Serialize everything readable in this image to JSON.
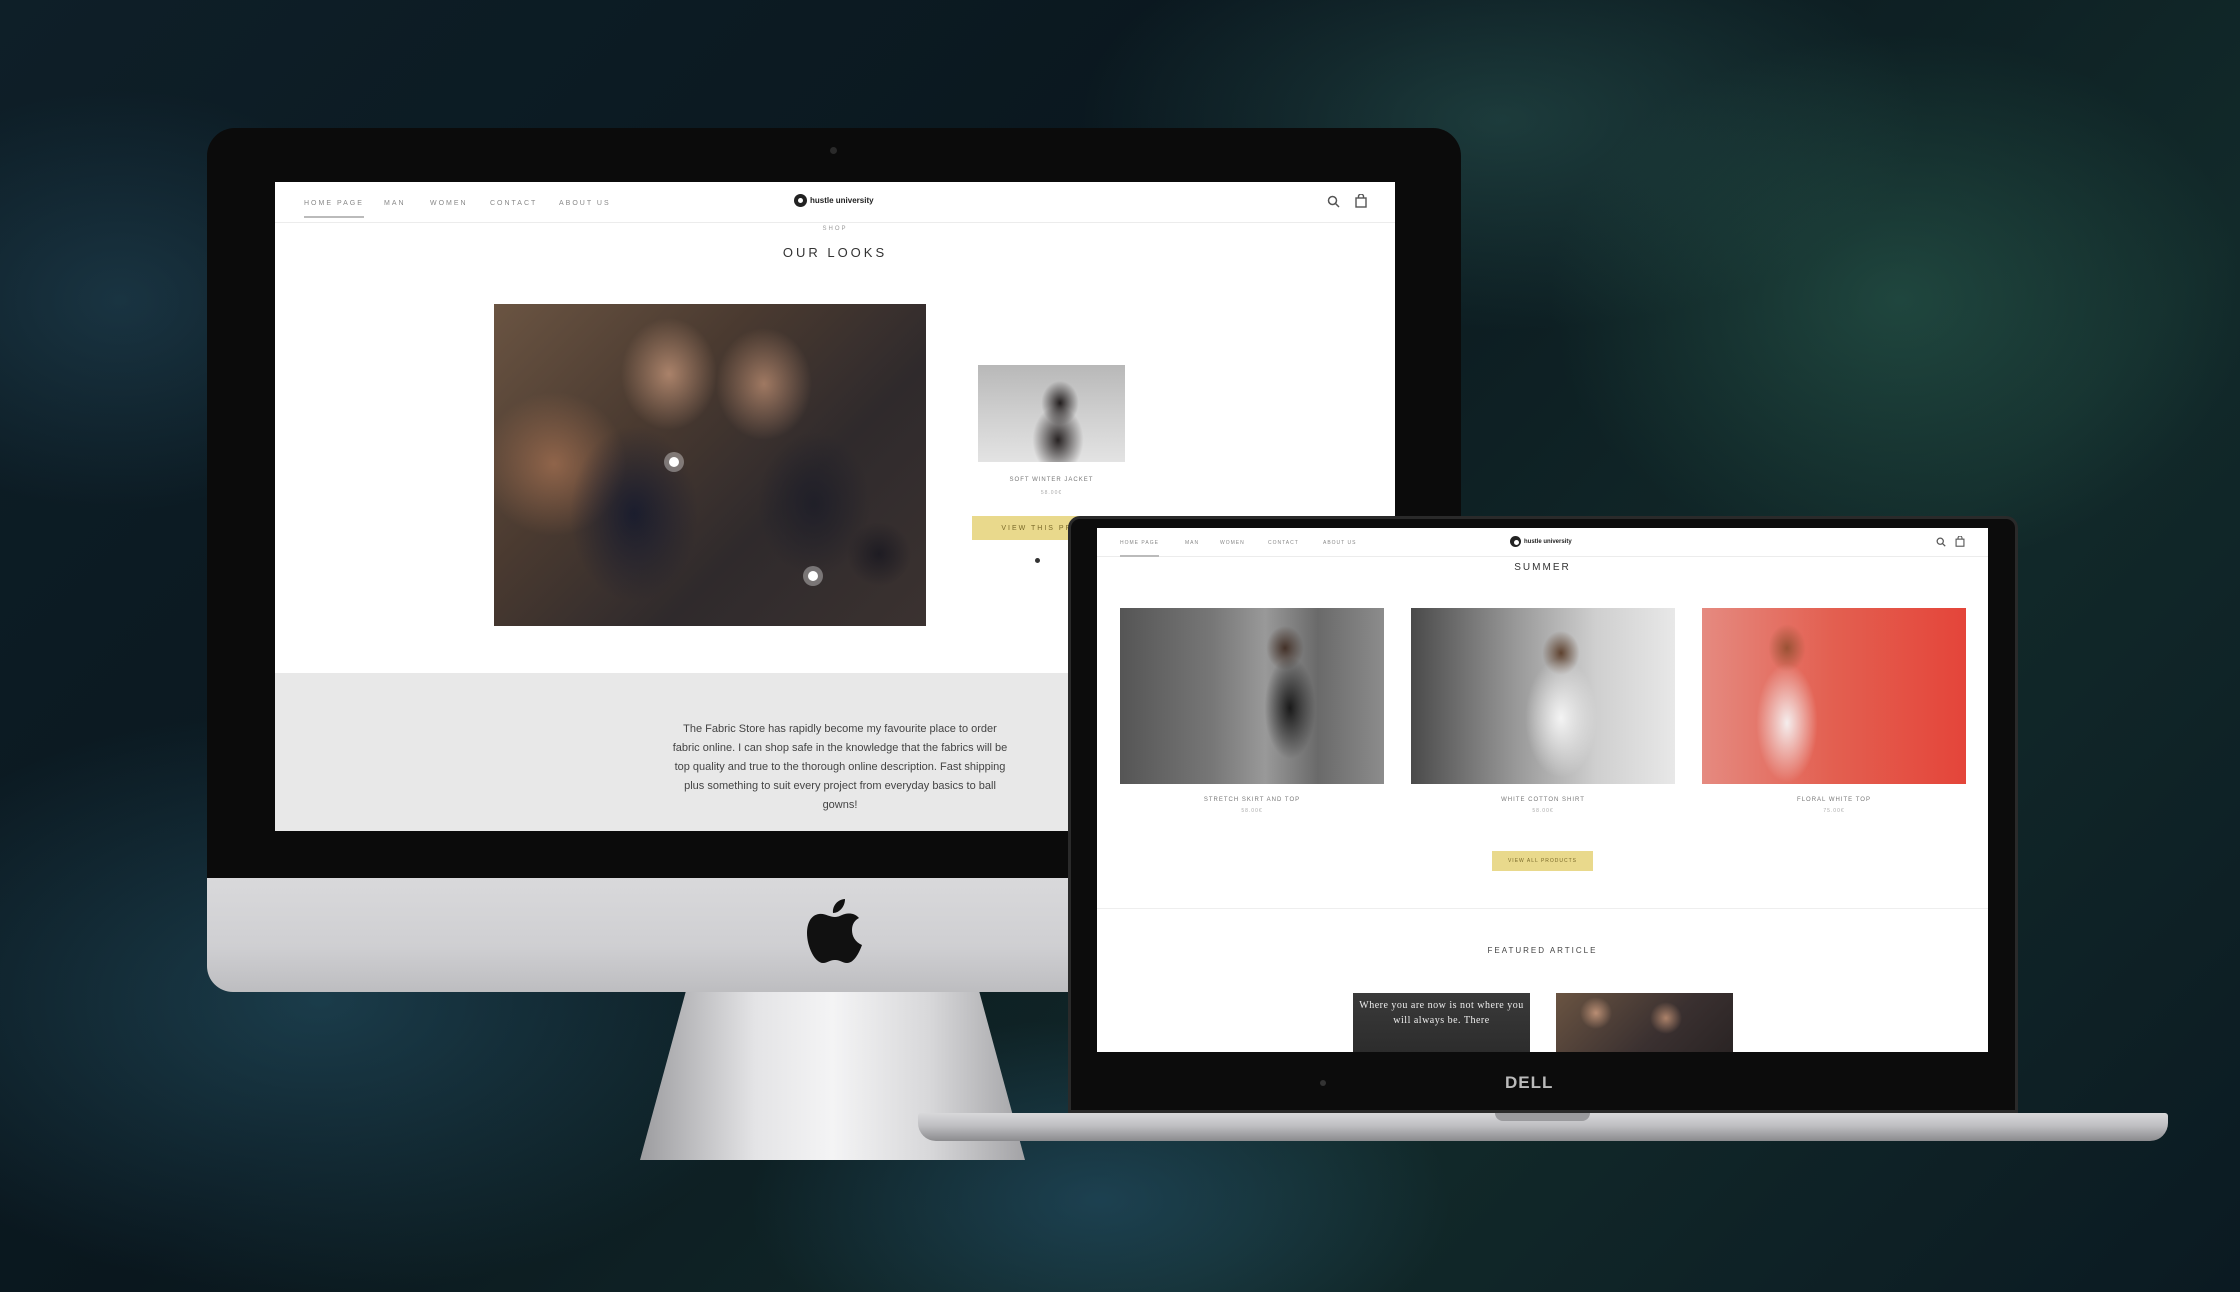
{
  "imac_site": {
    "nav": [
      "HOME PAGE",
      "MAN",
      "WOMEN",
      "CONTACT",
      "ABOUT US"
    ],
    "brand": "hustle university",
    "eyebrow": "SHOP",
    "title": "OUR LOOKS",
    "product": {
      "name": "SOFT WINTER JACKET",
      "price": "58.00€",
      "button": "VIEW THIS PR"
    },
    "testimonial": "The Fabric Store has rapidly become my favourite place to order fabric online. I can shop safe in the knowledge that the fabrics will be top quality and true to the thorough online description. Fast shipping plus something to suit every project from everyday basics to ball gowns!"
  },
  "dell_site": {
    "nav": [
      "HOME PAGE",
      "MAN",
      "WOMEN",
      "CONTACT",
      "ABOUT US"
    ],
    "brand": "hustle university",
    "title": "SUMMER",
    "products": [
      {
        "name": "STRETCH SKIRT AND TOP",
        "price": "58.00€"
      },
      {
        "name": "WHITE COTTON SHIRT",
        "price": "58.00€"
      },
      {
        "name": "FLORAL WHITE TOP",
        "price": "75.00€"
      }
    ],
    "view_all": "VIEW ALL PRODUCTS",
    "featured_title": "FEATURED ARTICLE",
    "article_quote": "Where you are now is not where you will always be. There"
  },
  "devices": {
    "laptop_brand": "DELL"
  },
  "colors": {
    "accent_yellow": "#e9d98c",
    "panel_gray": "#e8e8e8"
  }
}
